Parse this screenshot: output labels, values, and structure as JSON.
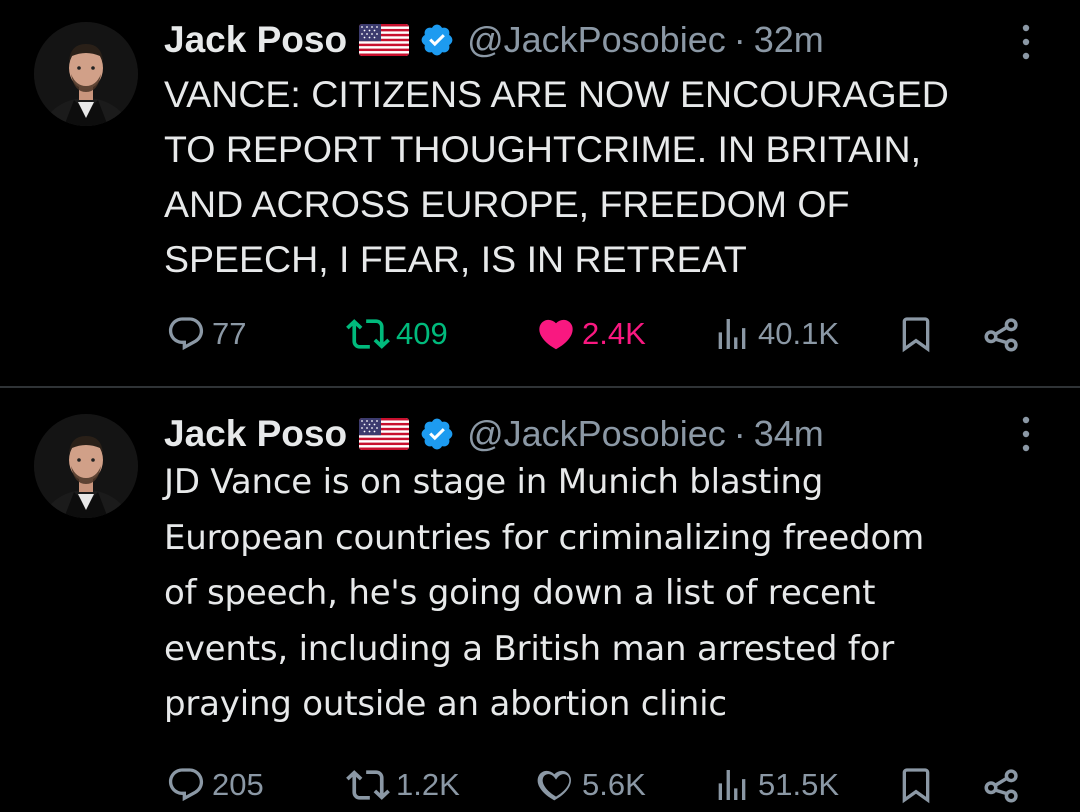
{
  "colors": {
    "background": "#000000",
    "text": "#e7e9ea",
    "muted": "#8b98a5",
    "verified": "#1d9bf0",
    "retweeted": "#00ba7c",
    "liked": "#f91880",
    "divider": "#2f3336"
  },
  "tweets": [
    {
      "display_name": "Jack Poso",
      "handle": "@JackPosobiec",
      "separator": "·",
      "time": "32m",
      "flag_icon": "us-flag-icon",
      "verified_icon": "verified-badge-icon",
      "text": "VANCE: CITIZENS ARE NOW ENCOURAGED\nTO REPORT THOUGHTCRIME. IN BRITAIN,\nAND ACROSS EUROPE, FREEDOM OF\nSPEECH, I FEAR, IS IN RETREAT",
      "replies": "77",
      "retweets": "409",
      "likes": "2.4K",
      "views": "40.1K",
      "retweeted": true,
      "liked": true
    },
    {
      "display_name": "Jack Poso",
      "handle": "@JackPosobiec",
      "separator": "·",
      "time": "34m",
      "flag_icon": "us-flag-icon",
      "verified_icon": "verified-badge-icon",
      "text": "JD Vance is on stage in Munich blasting\nEuropean countries for criminalizing freedom\nof speech, he's going down a list of recent\nevents, including a British man arrested for\npraying outside an abortion clinic",
      "replies": "205",
      "retweets": "1.2K",
      "likes": "5.6K",
      "views": "51.5K",
      "retweeted": false,
      "liked": false
    }
  ]
}
